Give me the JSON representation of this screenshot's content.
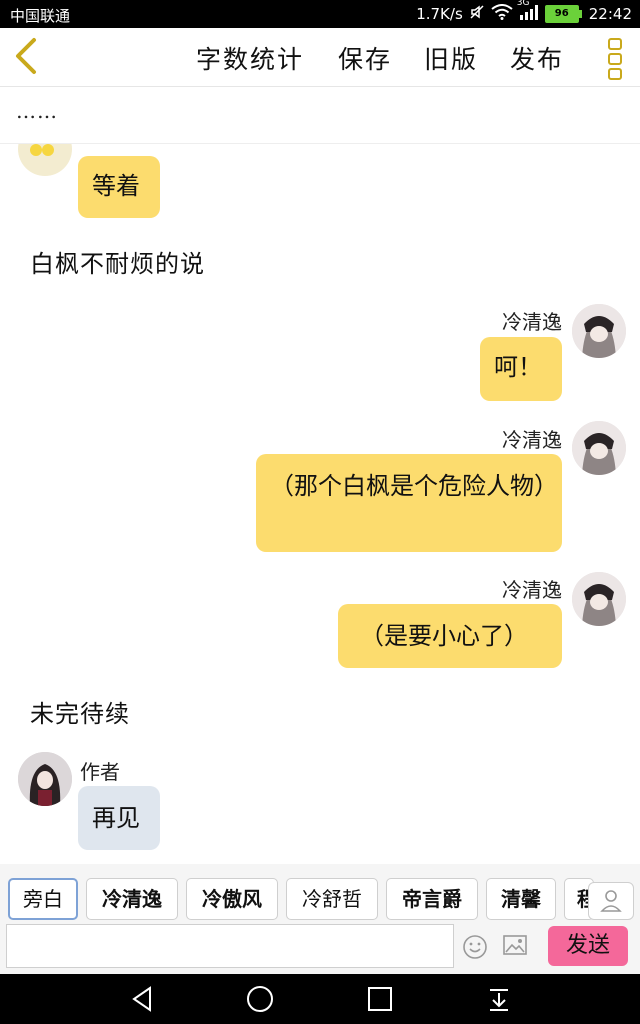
{
  "status_bar": {
    "carrier": "中国联通",
    "speed": "1.7K/s",
    "network": "3G",
    "battery": "96",
    "time": "22:42"
  },
  "toolbar": {
    "back_icon": "chevron-left-icon",
    "word_count": "字数统计",
    "save": "保存",
    "old_version": "旧版",
    "publish": "发布",
    "more_icon": "more-vertical-icon"
  },
  "subtitle": "……",
  "messages": [
    {
      "type": "left",
      "text": "等着"
    },
    {
      "type": "narration",
      "text": "白枫不耐烦的说"
    },
    {
      "type": "right",
      "name": "冷清逸",
      "text": "呵！"
    },
    {
      "type": "right",
      "name": "冷清逸",
      "text": "（那个白枫是个危险人物）"
    },
    {
      "type": "right",
      "name": "冷清逸",
      "text": "（是要小心了）"
    },
    {
      "type": "narration",
      "text": "未完待续"
    },
    {
      "type": "left",
      "name": "作者",
      "text": "再见"
    }
  ],
  "characters": [
    "旁白",
    "冷清逸",
    "冷傲风",
    "冷舒哲",
    "帝言爵",
    "清馨",
    "程"
  ],
  "input": {
    "value": "",
    "placeholder": ""
  },
  "send_label": "发送",
  "colors": {
    "bubble_yellow": "#fcdc6e",
    "bubble_grey": "#dfe6ee",
    "send_pink": "#f4689a",
    "accent_gold": "#c9a91c"
  }
}
